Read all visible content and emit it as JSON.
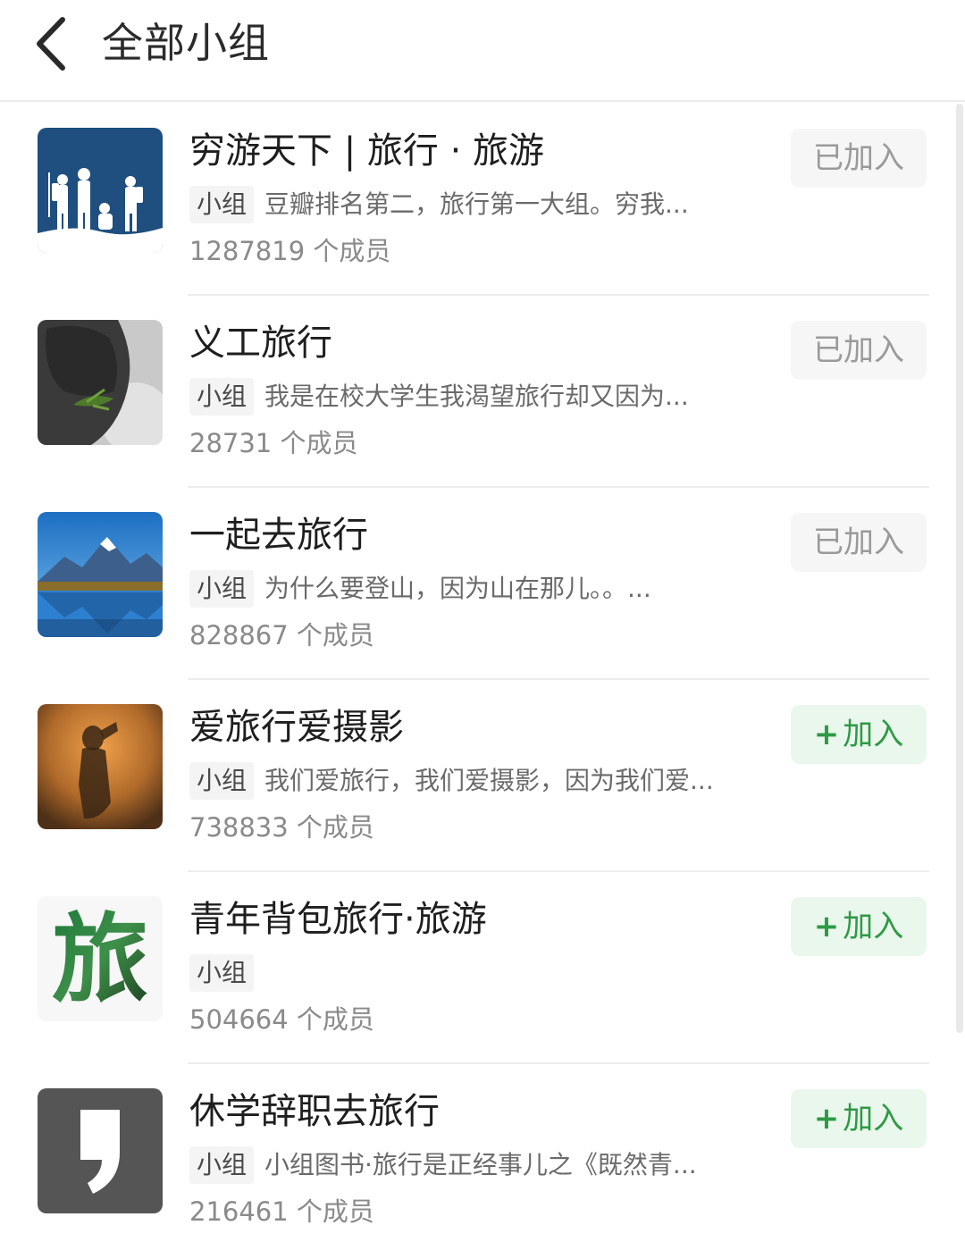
{
  "header": {
    "title": "全部小组",
    "back_icon": "chevron-left-icon"
  },
  "colors": {
    "joined_text": "#9a9a9a",
    "join_text": "#2e9a45",
    "join_bg": "#eaf7ec",
    "joined_bg": "#f6f6f6"
  },
  "groups": [
    {
      "name": "穷游天下 | 旅行 · 旅游",
      "tag": "小组",
      "desc": "豆瓣排名第二，旅行第一大组。穷我...",
      "members": "1287819 个成员",
      "button": "已加入",
      "joined": true,
      "avatar_icon": "hikers-silhouette-icon"
    },
    {
      "name": "义工旅行",
      "tag": "小组",
      "desc": "我是在校大学生我渴望旅行却又因为...",
      "members": "28731 个成员",
      "button": "已加入",
      "joined": true,
      "avatar_icon": "rock-plant-photo-icon"
    },
    {
      "name": "一起去旅行",
      "tag": "小组",
      "desc": "为什么要登山，因为山在那儿。。...",
      "members": "828867 个成员",
      "button": "已加入",
      "joined": true,
      "avatar_icon": "mountain-lake-photo-icon"
    },
    {
      "name": "爱旅行爱摄影",
      "tag": "小组",
      "desc": "我们爱旅行，我们爱摄影，因为我们爱...",
      "members": "738833 个成员",
      "button": "加入",
      "button_plus": "+",
      "joined": false,
      "avatar_icon": "shadow-photographer-icon"
    },
    {
      "name": "青年背包旅行·旅游",
      "tag": "小组",
      "desc": "",
      "members": "504664 个成员",
      "button": "加入",
      "button_plus": "+",
      "joined": false,
      "avatar_icon": "lv-character-icon",
      "avatar_char": "旅"
    },
    {
      "name": "休学辞职去旅行",
      "tag": "小组",
      "desc": "小组图书·旅行是正经事儿之《既然青...",
      "members": "216461 个成员",
      "button": "加入",
      "button_plus": "+",
      "joined": false,
      "avatar_icon": "quote-mark-icon"
    }
  ]
}
